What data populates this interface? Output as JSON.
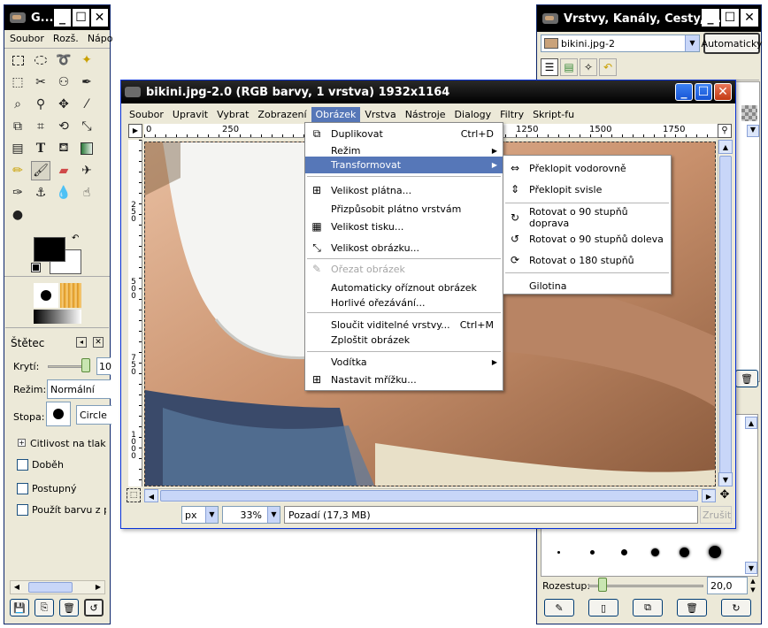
{
  "toolbox": {
    "title": "G...",
    "menu": [
      "Soubor",
      "Rozš.",
      "Nápo"
    ],
    "brush_panel": {
      "title": "Štětec",
      "opacity_label": "Krytí:",
      "opacity_value": "10",
      "mode_label": "Režim:",
      "mode_value": "Normální",
      "brush_label": "Stopa:",
      "brush_name": "Circle",
      "pressure_label": "Citlivost na tlak",
      "options": [
        "Doběh",
        "Postupný",
        "Použít barvu z př"
      ]
    }
  },
  "image_window": {
    "title": "bikini.jpg-2.0 (RGB barvy, 1 vrstva) 1932x1164",
    "menu": [
      "Soubor",
      "Upravit",
      "Vybrat",
      "Zobrazení",
      "Obrázek",
      "Vrstva",
      "Nástroje",
      "Dialogy",
      "Filtry",
      "Skript-fu"
    ],
    "ruler_labels": [
      "0",
      "250",
      "1250",
      "1500",
      "1750"
    ],
    "vruler_labels": [
      "2 5 0",
      "5 0 0",
      "7 5 0",
      "1 0 0 0"
    ],
    "status": {
      "unit": "px",
      "zoom": "33%",
      "info": "Pozadí (17,3 MB)",
      "cancel": "Zrušit"
    }
  },
  "image_menu": {
    "items": [
      {
        "label": "Duplikovat",
        "shortcut": "Ctrl+D",
        "icon": "duplicate-icon"
      },
      {
        "label": "Režim",
        "submenu": true
      },
      {
        "label": "Transformovat",
        "submenu": true,
        "active": true
      },
      {
        "label": "Velikost plátna...",
        "icon": "canvas-size-icon"
      },
      {
        "label": "Přizpůsobit plátno vrstvám"
      },
      {
        "label": "Velikost tisku...",
        "icon": "print-size-icon"
      },
      {
        "label": "Velikost obrázku...",
        "icon": "scale-icon"
      },
      {
        "label": "Ořezat obrázek",
        "disabled": true,
        "icon": "crop-icon"
      },
      {
        "label": "Automaticky oříznout obrázek"
      },
      {
        "label": "Horlivé ořezávání..."
      },
      {
        "label": "Sloučit viditelné vrstvy...",
        "shortcut": "Ctrl+M"
      },
      {
        "label": "Zploštit obrázek"
      },
      {
        "label": "Vodítka",
        "submenu": true
      },
      {
        "label": "Nastavit mřížku...",
        "icon": "grid-icon"
      }
    ]
  },
  "transform_menu": {
    "items": [
      {
        "label": "Překlopit vodorovně",
        "icon": "flip-horizontal-icon"
      },
      {
        "label": "Překlopit svisle",
        "icon": "flip-vertical-icon"
      },
      {
        "label": "Rotovat o 90 stupňů doprava",
        "icon": "rotate-cw-icon"
      },
      {
        "label": "Rotovat o 90 stupňů doleva",
        "icon": "rotate-ccw-icon"
      },
      {
        "label": "Rotovat o 180 stupňů",
        "icon": "rotate-180-icon"
      },
      {
        "label": "Gilotina"
      }
    ]
  },
  "layers_dock": {
    "title": "Vrstvy, Kanály, Cesty, ...",
    "image_select": "bikini.jpg-2",
    "auto_button": "Automaticky",
    "spacing_label": "Rozestup:",
    "spacing_value": "20,0"
  },
  "colors": {
    "menu_highlight": "#5677b8",
    "titlebar": "#000000",
    "xp_blue": "#2a64e0"
  }
}
